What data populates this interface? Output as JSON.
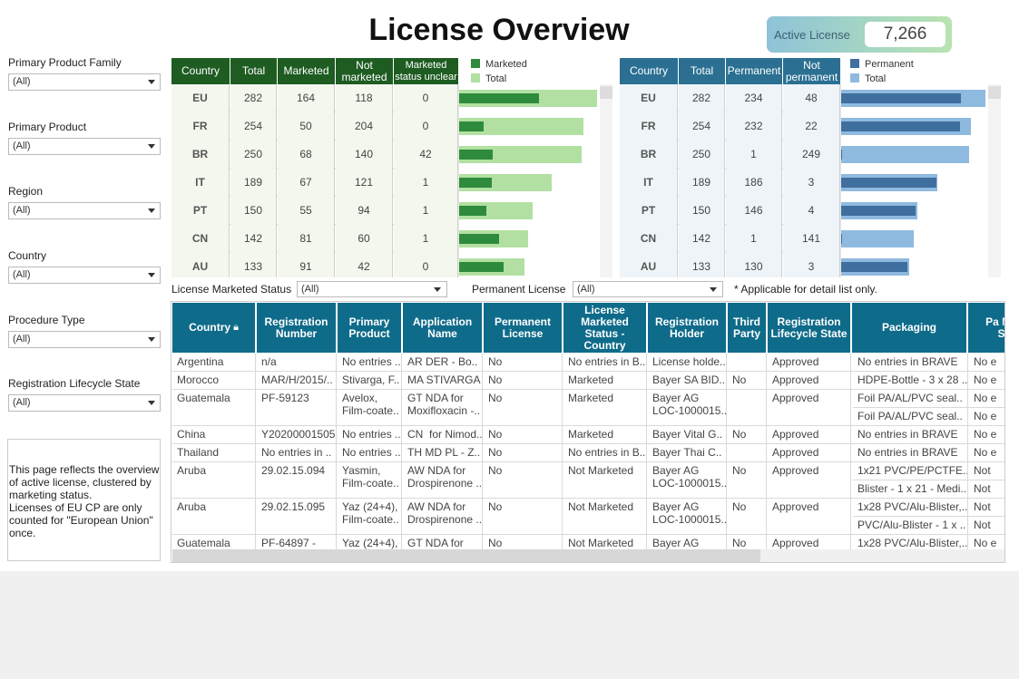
{
  "title": "License Overview",
  "kpi": {
    "label": "Active License",
    "value": "7,266"
  },
  "filters": [
    {
      "label": "Primary Product Family",
      "value": "(All)"
    },
    {
      "label": "Primary Product",
      "value": "(All)"
    },
    {
      "label": "Region",
      "value": "(All)"
    },
    {
      "label": "Country",
      "value": "(All)"
    },
    {
      "label": "Procedure Type",
      "value": "(All)"
    },
    {
      "label": "Registration Lifecycle State",
      "value": "(All)"
    }
  ],
  "note": "This page reflects the overview of active license, clustered by marketing status.\nLicenses of EU CP are only counted for \"European Union\" once.",
  "marketed_table": {
    "headers": [
      "Country",
      "Total",
      "Marketed",
      "Not marketed",
      "Marketed status unclear"
    ],
    "legend": [
      "Marketed",
      "Total"
    ],
    "colors": {
      "dark": "#2e8b3c",
      "light": "#b2e0a2"
    },
    "rows": [
      {
        "country": "EU",
        "total": "282",
        "marketed": "164",
        "not_marketed": "118",
        "unclear": "0"
      },
      {
        "country": "FR",
        "total": "254",
        "marketed": "50",
        "not_marketed": "204",
        "unclear": "0"
      },
      {
        "country": "BR",
        "total": "250",
        "marketed": "68",
        "not_marketed": "140",
        "unclear": "42"
      },
      {
        "country": "IT",
        "total": "189",
        "marketed": "67",
        "not_marketed": "121",
        "unclear": "1"
      },
      {
        "country": "PT",
        "total": "150",
        "marketed": "55",
        "not_marketed": "94",
        "unclear": "1"
      },
      {
        "country": "CN",
        "total": "142",
        "marketed": "81",
        "not_marketed": "60",
        "unclear": "1"
      },
      {
        "country": "AU",
        "total": "133",
        "marketed": "91",
        "not_marketed": "42",
        "unclear": "0"
      }
    ]
  },
  "permanent_table": {
    "headers": [
      "Country",
      "Total",
      "Permanent",
      "Not permanent"
    ],
    "legend": [
      "Permanent",
      "Total"
    ],
    "colors": {
      "dark": "#3f6f9e",
      "light": "#8fbadf"
    },
    "rows": [
      {
        "country": "EU",
        "total": "282",
        "permanent": "234",
        "not_permanent": "48"
      },
      {
        "country": "FR",
        "total": "254",
        "permanent": "232",
        "not_permanent": "22"
      },
      {
        "country": "BR",
        "total": "250",
        "permanent": "1",
        "not_permanent": "249"
      },
      {
        "country": "IT",
        "total": "189",
        "permanent": "186",
        "not_permanent": "3"
      },
      {
        "country": "PT",
        "total": "150",
        "permanent": "146",
        "not_permanent": "4"
      },
      {
        "country": "CN",
        "total": "142",
        "permanent": "1",
        "not_permanent": "141"
      },
      {
        "country": "AU",
        "total": "133",
        "permanent": "130",
        "not_permanent": "3"
      }
    ]
  },
  "detail_filters": {
    "marketed_label": "License Marketed Status",
    "marketed_value": "(All)",
    "permanent_label": "Permanent License",
    "permanent_value": "(All)",
    "note": "* Applicable for detail list only."
  },
  "detail_table": {
    "headers": [
      "Country",
      "Registration Number",
      "Primary Product",
      "Application Name",
      "Permanent License",
      "License Marketed Status - Country",
      "Registration Holder",
      "Third Party",
      "Registration Lifecycle State",
      "Packaging",
      "Pa Ma S"
    ],
    "rows": [
      {
        "cells": [
          "Argentina",
          "n/a",
          "No entries ..",
          "AR DER - Bo..",
          "No",
          "No entries in B..",
          "License holde..",
          "",
          "Approved"
        ],
        "packaging": [
          [
            "No entries in BRAVE",
            "No e"
          ]
        ]
      },
      {
        "cells": [
          "Morocco",
          "MAR/H/2015/..",
          "Stivarga, F..",
          "MA STIVARGA",
          "No",
          "Marketed",
          "Bayer SA BID..",
          "No",
          "Approved"
        ],
        "packaging": [
          [
            "HDPE-Bottle - 3 x 28 ..",
            "No e"
          ]
        ]
      },
      {
        "cells": [
          "Guatemala",
          "PF-59123",
          "Avelox,\nFilm-coate..",
          "GT NDA for\nMoxifloxacin -..",
          "No",
          "Marketed",
          "Bayer AG\nLOC-1000015..",
          "",
          "Approved"
        ],
        "packaging": [
          [
            "Foil PA/AL/PVC seal..",
            "No e"
          ],
          [
            "Foil PA/AL/PVC seal..",
            "No e"
          ]
        ]
      },
      {
        "cells": [
          "China",
          "Y20200001505",
          "No entries ..",
          "CN  for Nimod..",
          "No",
          "Marketed",
          "Bayer Vital G..",
          "No",
          "Approved"
        ],
        "packaging": [
          [
            "No entries in BRAVE",
            "No e"
          ]
        ]
      },
      {
        "cells": [
          "Thailand",
          "No entries in ..",
          "No entries ..",
          "TH MD PL - Z..",
          "No",
          "No entries in B..",
          "Bayer Thai C..",
          "",
          "Approved"
        ],
        "packaging": [
          [
            "No entries in BRAVE",
            "No e"
          ]
        ]
      },
      {
        "cells": [
          "Aruba",
          "29.02.15.094",
          "Yasmin,\nFilm-coate..",
          "AW NDA for\nDrospirenone ..",
          "No",
          "Not Marketed",
          "Bayer AG\nLOC-1000015..",
          "No",
          "Approved"
        ],
        "packaging": [
          [
            "1x21 PVC/PE/PCTFE..",
            "Not"
          ],
          [
            "Blister - 1 x 21 - Medi..",
            "Not"
          ]
        ]
      },
      {
        "cells": [
          "Aruba",
          "29.02.15.095",
          "Yaz (24+4),\nFilm-coate..",
          "AW NDA for\nDrospirenone ..",
          "No",
          "Not Marketed",
          "Bayer AG\nLOC-1000015..",
          "No",
          "Approved"
        ],
        "packaging": [
          [
            "1x28 PVC/Alu-Blister,..",
            "Not"
          ],
          [
            "PVC/Alu-Blister - 1 x ..",
            "Not"
          ]
        ]
      },
      {
        "cells": [
          "Guatemala",
          "PF-64897 -",
          "Yaz (24+4),",
          "GT NDA for",
          "No",
          "Not Marketed",
          "Bayer AG",
          "No",
          "Approved"
        ],
        "packaging": [
          [
            "1x28 PVC/Alu-Blister,..",
            "No e"
          ]
        ]
      }
    ]
  }
}
